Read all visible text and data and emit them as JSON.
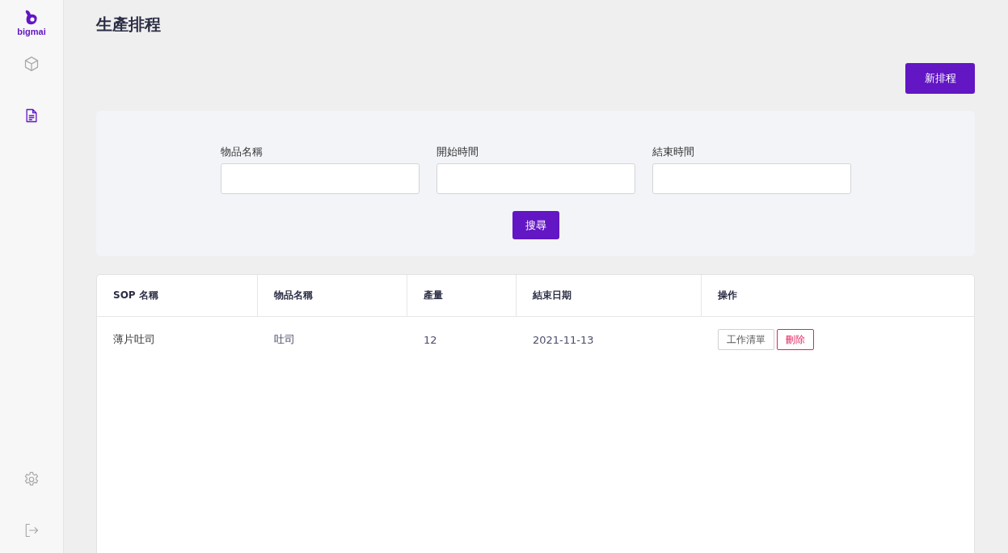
{
  "sidebar": {
    "logo": "bigmai",
    "items": [
      {
        "kind": "box",
        "selected": false
      },
      {
        "kind": "document",
        "selected": true
      }
    ],
    "bottom_items": [
      {
        "kind": "settings"
      },
      {
        "kind": "logout"
      }
    ]
  },
  "page_title": "生產排程",
  "new_button": "新排程",
  "filters": {
    "fields": [
      {
        "label": "物品名稱"
      },
      {
        "label": "開始時間"
      },
      {
        "label": "結束時間"
      }
    ],
    "search_button": "搜尋"
  },
  "table": {
    "columns": [
      "SOP 名稱",
      "物品名稱",
      "產量",
      "結束日期",
      "操作"
    ],
    "rows": [
      {
        "cells": [
          "薄片吐司",
          "吐司",
          "12",
          "2021-11-13"
        ],
        "actions": [
          {
            "label": "工作清單",
            "kind": "default"
          },
          {
            "label": "刪除",
            "kind": "danger"
          }
        ]
      }
    ]
  }
}
